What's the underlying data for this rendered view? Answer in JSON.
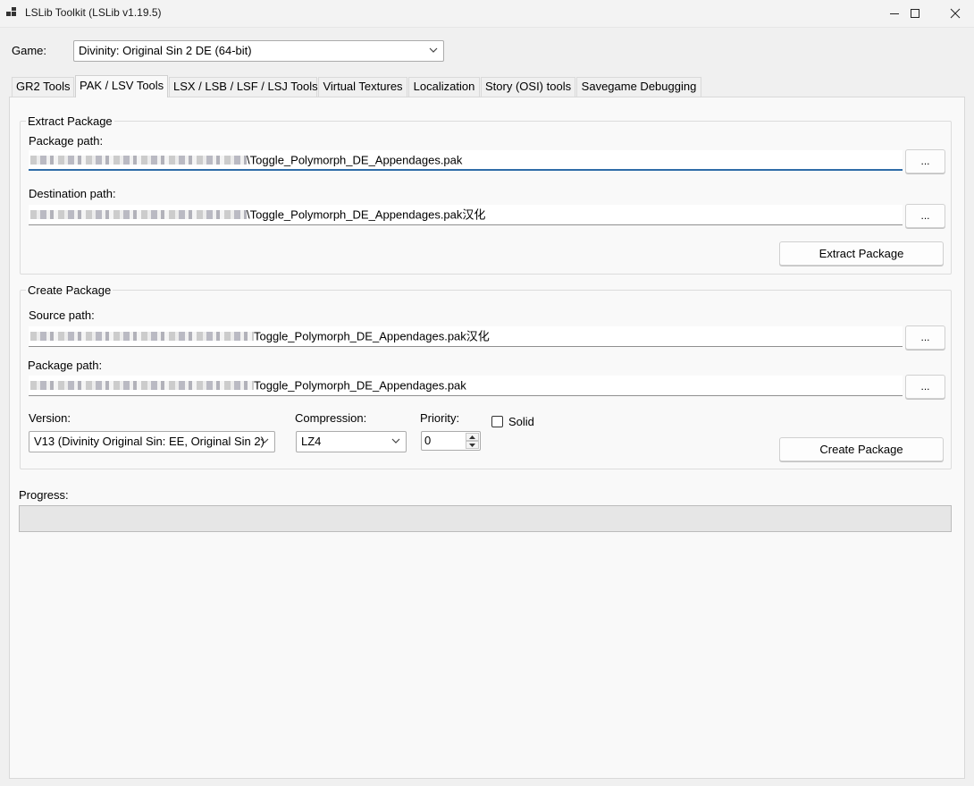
{
  "window": {
    "title": "LSLib Toolkit (LSLib v1.19.5)"
  },
  "game": {
    "label": "Game:",
    "selected": "Divinity: Original Sin 2 DE (64-bit)"
  },
  "tabs": [
    {
      "label": "GR2 Tools"
    },
    {
      "label": "PAK / LSV Tools"
    },
    {
      "label": "LSX / LSB / LSF / LSJ Tools"
    },
    {
      "label": "Virtual Textures"
    },
    {
      "label": "Localization"
    },
    {
      "label": "Story (OSI) tools"
    },
    {
      "label": "Savegame Debugging"
    }
  ],
  "active_tab_index": 1,
  "extract": {
    "title": "Extract Package",
    "package_path_label": "Package path:",
    "package_path_value": "\\Toggle_Polymorph_DE_Appendages.pak",
    "destination_path_label": "Destination path:",
    "destination_path_value": "\\Toggle_Polymorph_DE_Appendages.pak汉化",
    "browse_label": "...",
    "button_label": "Extract Package"
  },
  "create": {
    "title": "Create Package",
    "source_path_label": "Source path:",
    "source_path_value": "Toggle_Polymorph_DE_Appendages.pak汉化",
    "package_path_label": "Package path:",
    "package_path_value": "Toggle_Polymorph_DE_Appendages.pak",
    "browse_label": "...",
    "version_label": "Version:",
    "version_value": "V13 (Divinity Original Sin: EE, Original Sin 2)",
    "compression_label": "Compression:",
    "compression_value": "LZ4",
    "priority_label": "Priority:",
    "priority_value": "0",
    "solid_label": "Solid",
    "solid_checked": false,
    "button_label": "Create Package"
  },
  "progress": {
    "label": "Progress:",
    "value_percent": 0
  },
  "colors": {
    "window_bg": "#f0f0f0",
    "tab_page_bg": "#f9f9f9",
    "focus_accent": "#2f6ca8"
  }
}
